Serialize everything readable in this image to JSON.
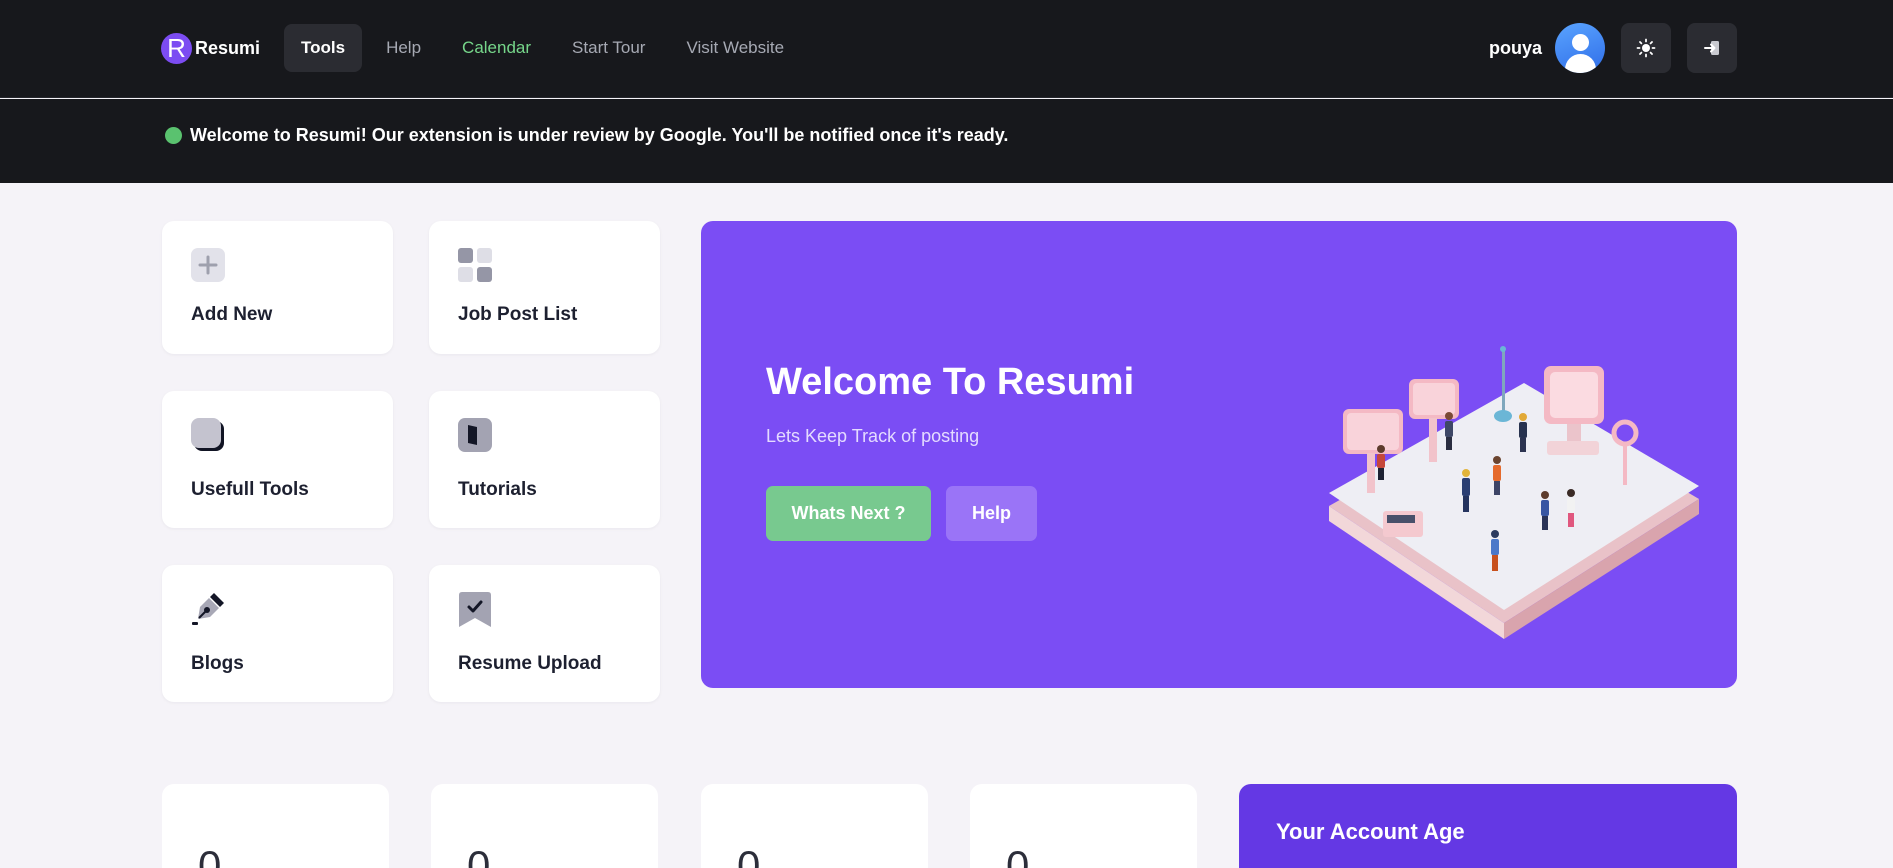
{
  "brand": {
    "logo_letter": "R",
    "name": "Resumi"
  },
  "nav": {
    "items": [
      {
        "label": "Tools"
      },
      {
        "label": "Help"
      },
      {
        "label": "Calendar"
      },
      {
        "label": "Start Tour"
      },
      {
        "label": "Visit Website"
      }
    ]
  },
  "user": {
    "name": "pouya",
    "theme_icon": "sun-icon",
    "logout_icon": "logout-icon"
  },
  "banner": {
    "status_color": "#5ac26f",
    "text": "Welcome to Resumi! Our extension is under review by Google. You'll be notified once it's ready."
  },
  "tools": [
    {
      "label": "Add New",
      "icon": "plus-icon"
    },
    {
      "label": "Job Post List",
      "icon": "grid-icon"
    },
    {
      "label": "Usefull Tools",
      "icon": "tools-icon"
    },
    {
      "label": "Tutorials",
      "icon": "book-icon"
    },
    {
      "label": "Blogs",
      "icon": "pen-icon"
    },
    {
      "label": "Resume Upload",
      "icon": "bookmark-check-icon"
    }
  ],
  "hero": {
    "title": "Welcome To Resumi",
    "subtitle": "Lets Keep Track of posting",
    "primary_button": "Whats Next ?",
    "secondary_button": "Help",
    "illustration": "job-fair-illustration"
  },
  "stats": [
    {
      "value": "0"
    },
    {
      "value": "0"
    },
    {
      "value": "0"
    },
    {
      "value": "0"
    }
  ],
  "account_age": {
    "title": "Your Account Age"
  },
  "colors": {
    "accent": "#7b4df4",
    "nav_bg": "#17181c",
    "green": "#78c98f",
    "page_bg": "#f5f3f8"
  }
}
